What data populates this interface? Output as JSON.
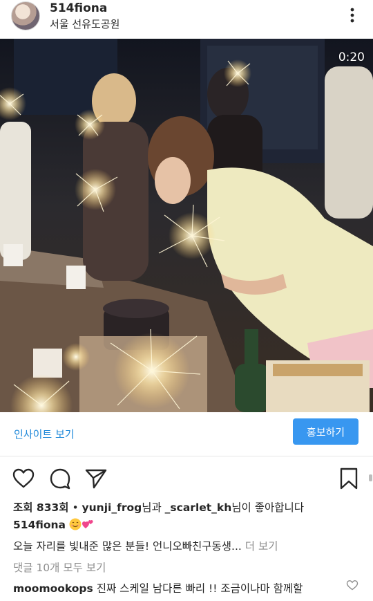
{
  "header": {
    "username": "514fiona",
    "location": "서울 선유도공원",
    "avatar_icon": "profile-avatar",
    "more_icon": "vertical-ellipsis-icon"
  },
  "media": {
    "timer": "0:20"
  },
  "insight_bar": {
    "insights_link": "인사이트 보기",
    "promote_button": "홍보하기",
    "promote_color": "#3897f0"
  },
  "actions": {
    "like_icon": "heart-outline-icon",
    "comment_icon": "comment-bubble-icon",
    "share_icon": "paper-plane-icon",
    "save_icon": "bookmark-icon"
  },
  "stats": {
    "views_label": "조회 833회",
    "separator": " • ",
    "liker1": "yunji_frog",
    "conj": "님과 ",
    "liker2": "_scarlet_kh",
    "suffix": "님이 좋아합니다"
  },
  "caption": {
    "author": "514fiona",
    "emoji_icons": [
      "smiling-face-icon",
      "two-hearts-icon"
    ],
    "text": "오늘 자리를 빛내준 많은 분들! 언니오빠친구동생...",
    "more_link": "더 보기"
  },
  "comments": {
    "view_all": "댓글 10개 모두 보기",
    "items": [
      {
        "username": "moomookops",
        "text": "진짜 스케일 남다른 빠리 !! 조금이나마 함께할"
      }
    ]
  },
  "colors": {
    "link_blue": "#1e88d9",
    "text_dark": "#262626",
    "text_grey": "#8e8e8e"
  }
}
